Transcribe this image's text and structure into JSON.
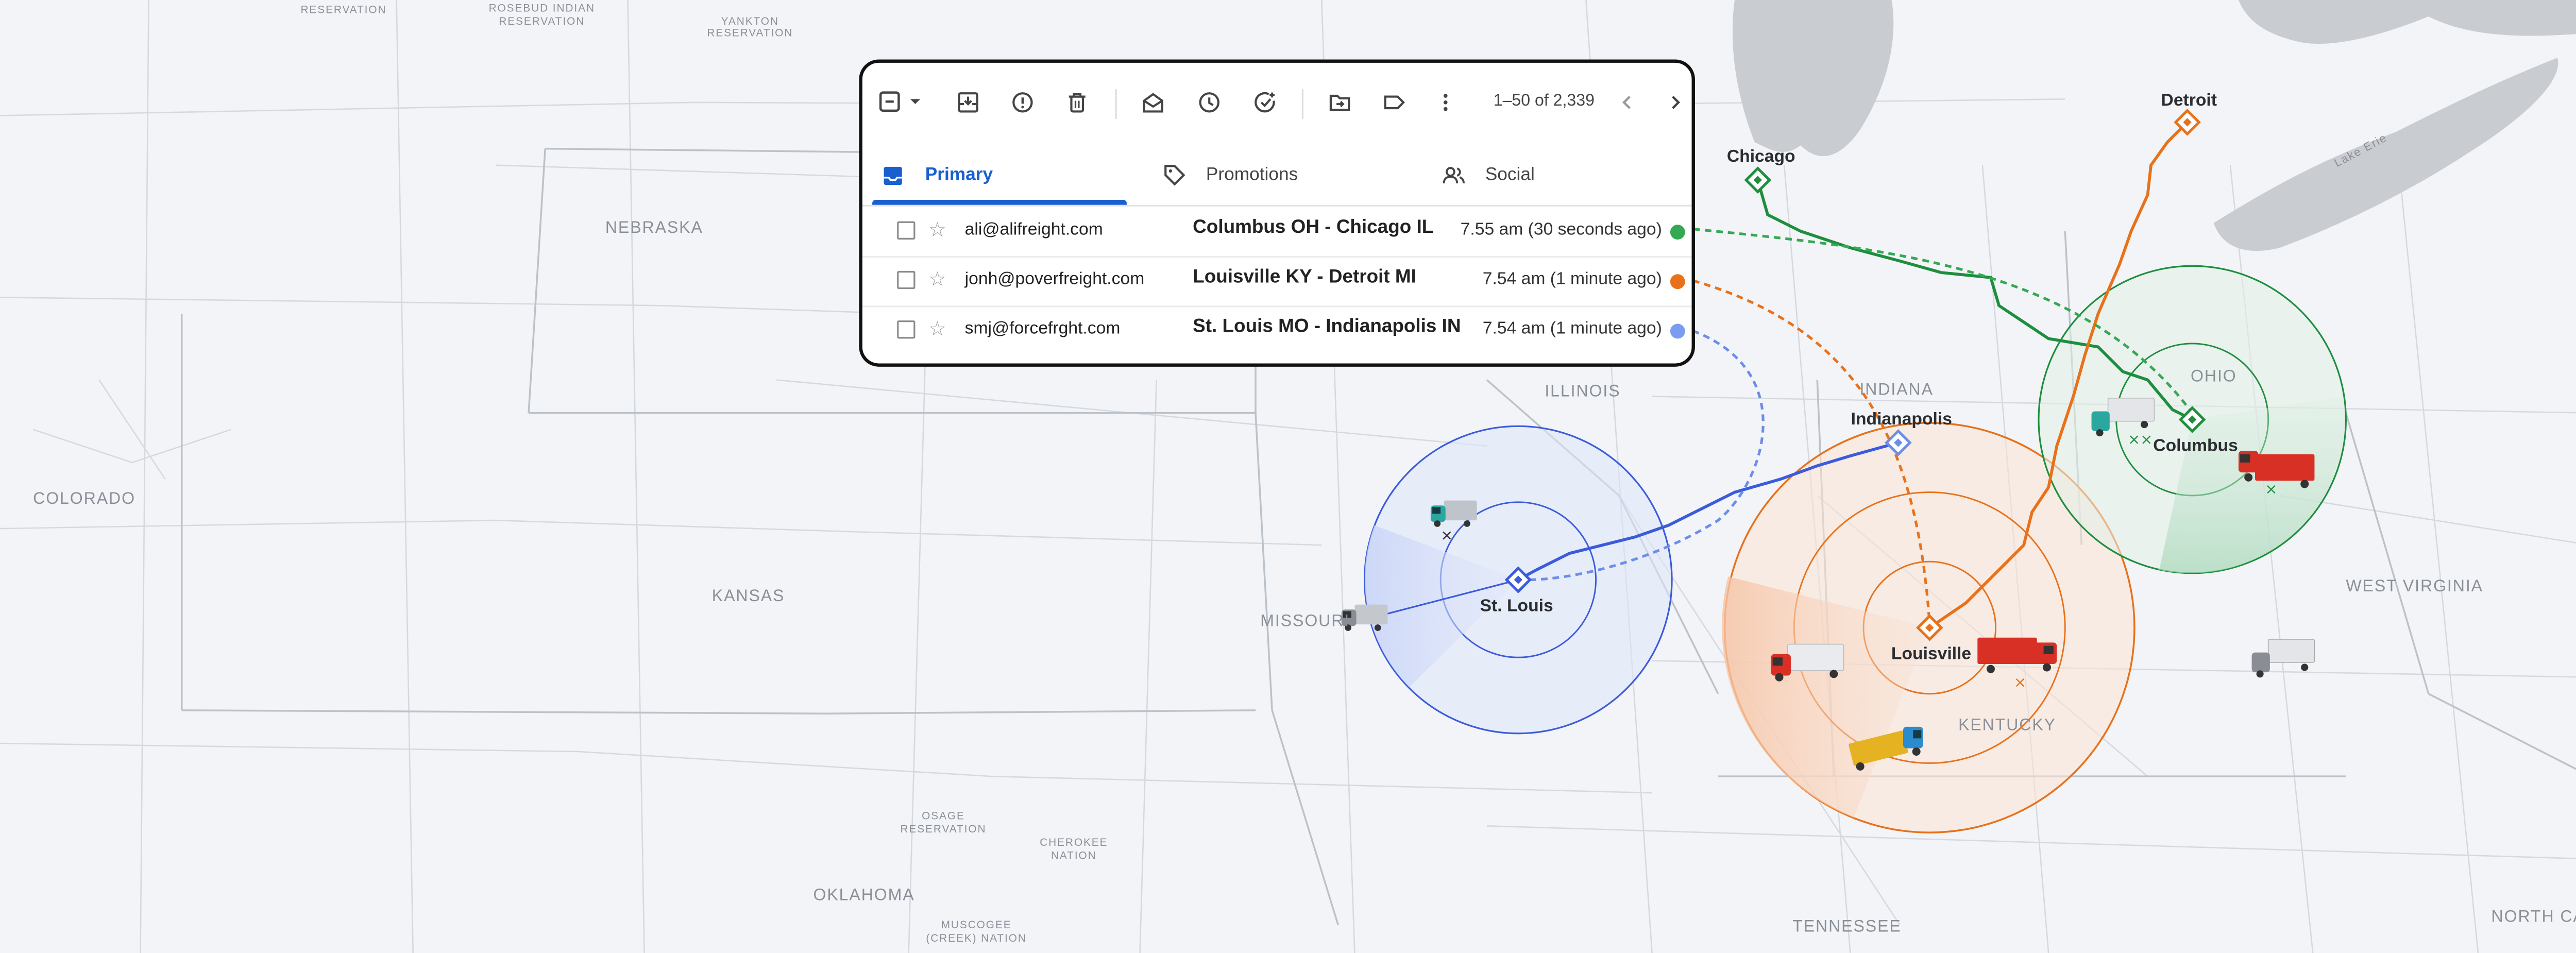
{
  "map": {
    "states": [
      {
        "label": "NEBRASKA"
      },
      {
        "label": "KANSAS"
      },
      {
        "label": "COLORADO"
      },
      {
        "label": "OKLAHOMA"
      },
      {
        "label": "MISSOURI"
      },
      {
        "label": "ILLINOIS"
      },
      {
        "label": "INDIANA"
      },
      {
        "label": "OHIO"
      },
      {
        "label": "KENTUCKY"
      },
      {
        "label": "TENNESSEE"
      },
      {
        "label": "WEST VIRGINIA"
      },
      {
        "label": "NORTH CAROLINA"
      }
    ],
    "minor": [
      {
        "label": "RESERVATION"
      },
      {
        "label": "ROSEBUD INDIAN"
      },
      {
        "label": "RESERVATION"
      },
      {
        "label": "YANKTON"
      },
      {
        "label": "RESERVATION"
      },
      {
        "label": "OSAGE"
      },
      {
        "label": "RESERVATION"
      },
      {
        "label": "CHEROKEE"
      },
      {
        "label": "NATION"
      },
      {
        "label": "MUSCOGEE"
      },
      {
        "label": "(CREEK) NATION"
      },
      {
        "label": "Lake Erie"
      }
    ],
    "cities": [
      {
        "label": "Chicago"
      },
      {
        "label": "Detroit"
      },
      {
        "label": "Indianapolis"
      },
      {
        "label": "Columbus"
      },
      {
        "label": "St. Louis"
      },
      {
        "label": "Louisville"
      }
    ],
    "colors": {
      "green": "#1e8e3e",
      "orange": "#e8711a",
      "blue": "#3b5bdb"
    }
  },
  "inbox": {
    "pagination": "1–50 of 2,339",
    "tabs": [
      {
        "label": "Primary",
        "icon": "inbox-icon"
      },
      {
        "label": "Promotions",
        "icon": "tag-icon"
      },
      {
        "label": "Social",
        "icon": "people-icon"
      }
    ],
    "messages": [
      {
        "from": "ali@alifreight.com",
        "subject": "Columbus OH - Chicago IL",
        "time": "7.55 am (30 seconds ago)",
        "color": "#34a853"
      },
      {
        "from": "jonh@poverfreight.com",
        "subject": "Louisville KY - Detroit MI",
        "time": "7.54 am (1 minute ago)",
        "color": "#e8711a"
      },
      {
        "from": "smj@forcefrght.com",
        "subject": "St. Louis MO  - Indianapolis IN",
        "time": "7.54 am (1 minute ago)",
        "color": "#7b9cf0"
      }
    ]
  }
}
